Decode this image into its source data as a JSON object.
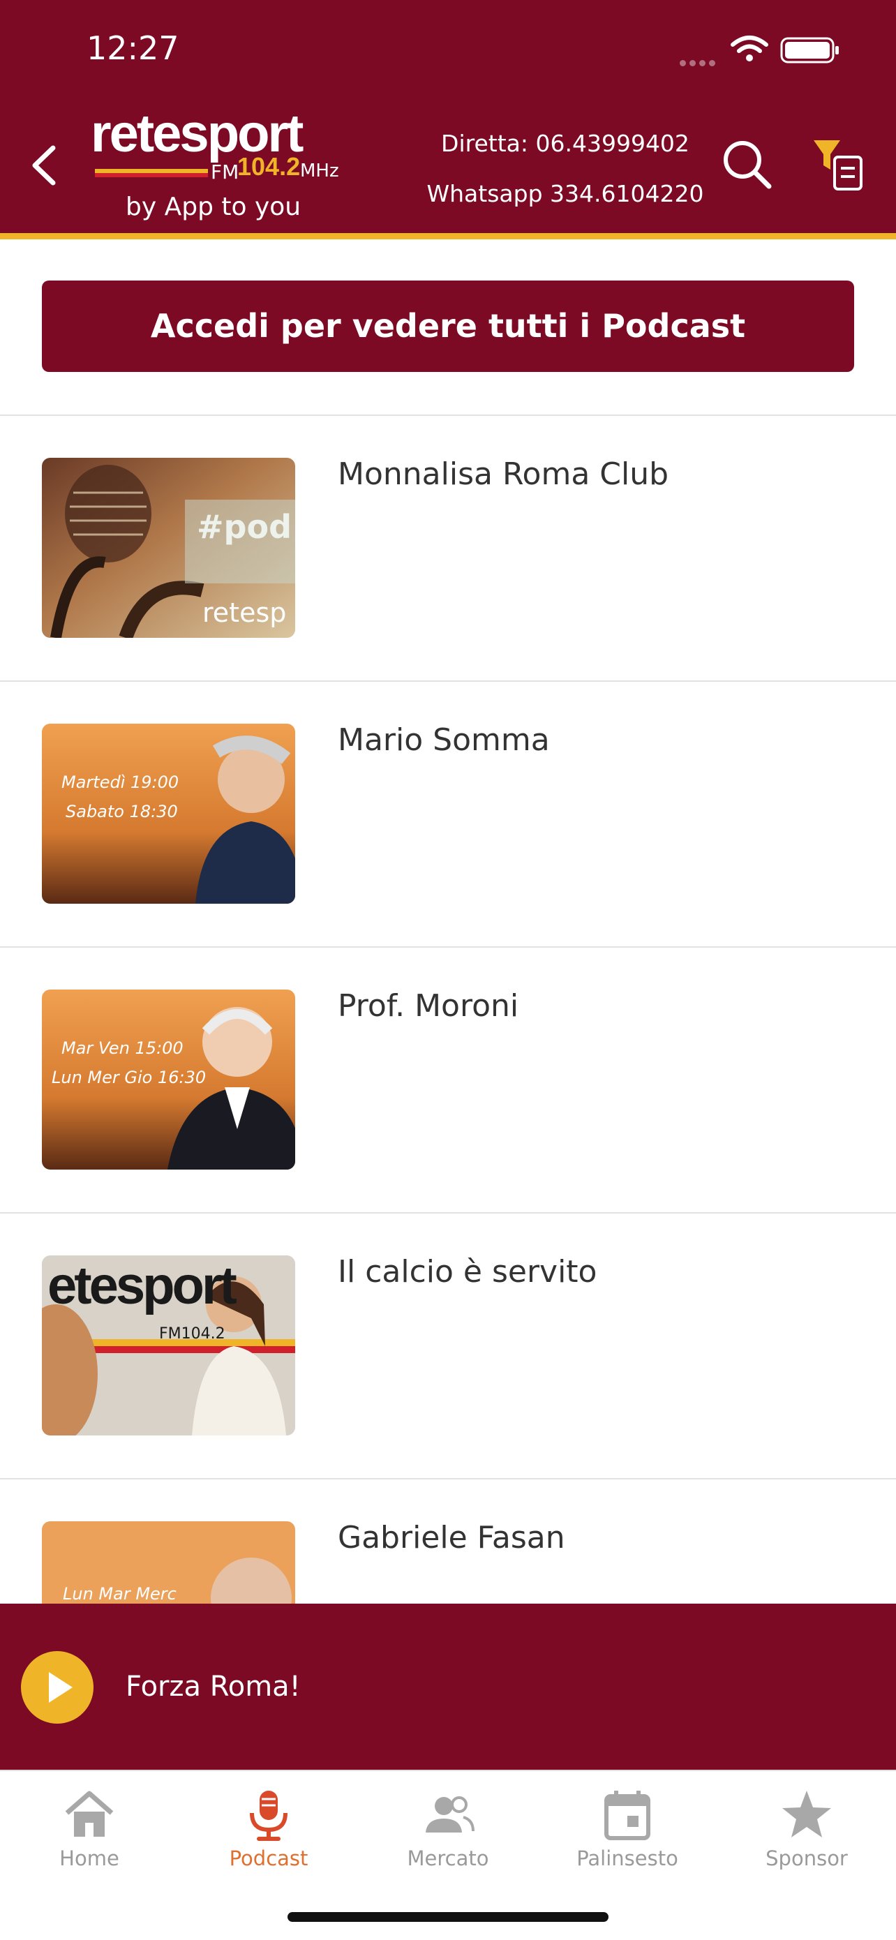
{
  "status_bar": {
    "time": "12:27"
  },
  "header": {
    "logo_word": "retesport",
    "logo_fm": "FM",
    "logo_freq": "104.2",
    "logo_mhz": "MHz",
    "tagline": "by App to you",
    "phone_label": "Diretta: 06.43999402",
    "whatsapp_label": "Whatsapp 334.6104220",
    "icons": [
      "back-chevron",
      "search",
      "filter-list"
    ]
  },
  "login_button": {
    "label": "Accedi per vedere tutti i Podcast"
  },
  "podcasts": [
    {
      "title": "Monnalisa Roma Club",
      "thumb_text": "#pod",
      "thumb_sub": "retesp"
    },
    {
      "title": "Mario Somma",
      "thumb_line1": "Martedì 19:00",
      "thumb_line2": "Sabato 18:30"
    },
    {
      "title": "Prof. Moroni",
      "thumb_line1": "Mar Ven 15:00",
      "thumb_line2": "Lun Mer Gio 16:30"
    },
    {
      "title": "Il calcio è servito",
      "thumb_text": "etesport",
      "thumb_sub": "FM104.2"
    },
    {
      "title": "Gabriele Fasan",
      "thumb_line1": "Lun Mar Merc"
    }
  ],
  "player": {
    "label": "Forza Roma!"
  },
  "tabs": [
    {
      "label": "Home",
      "icon": "home-icon",
      "active": false
    },
    {
      "label": "Podcast",
      "icon": "microphone-icon",
      "active": true
    },
    {
      "label": "Mercato",
      "icon": "people-icon",
      "active": false
    },
    {
      "label": "Palinsesto",
      "icon": "calendar-icon",
      "active": false
    },
    {
      "label": "Sponsor",
      "icon": "star-icon",
      "active": false
    }
  ],
  "colors": {
    "brand": "#7c0a25",
    "accent": "#f0b429",
    "active_tab": "#e07030",
    "inactive_tab": "#9a9a9a"
  }
}
